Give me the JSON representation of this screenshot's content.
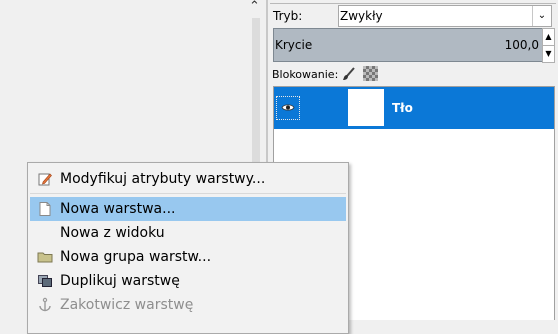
{
  "layers_panel": {
    "mode_label": "Tryb:",
    "mode_value": "Zwykły",
    "opacity_label": "Krycie",
    "opacity_value": "100,0",
    "lock_label": "Blokowanie:",
    "layers": [
      {
        "name": "Tło",
        "visible": true,
        "selected": true
      }
    ]
  },
  "context_menu": {
    "items": [
      {
        "label": "Modyfikuj atrybuty warstwy...",
        "icon": "edit-icon",
        "disabled": false
      },
      {
        "label": "Nowa warstwa...",
        "icon": "new-document-icon",
        "disabled": false,
        "highlighted": true
      },
      {
        "label": "Nowa z widoku",
        "icon": "",
        "disabled": false
      },
      {
        "label": "Nowa grupa warstw...",
        "icon": "folder-icon",
        "disabled": false
      },
      {
        "label": "Duplikuj warstwę",
        "icon": "duplicate-icon",
        "disabled": false
      },
      {
        "label": "Zakotwicz warstwę",
        "icon": "anchor-icon",
        "disabled": true
      }
    ]
  },
  "colors": {
    "selection": "#0b78d7",
    "menu_highlight": "#98c8ef",
    "opacity_bar": "#b0b9c2"
  }
}
